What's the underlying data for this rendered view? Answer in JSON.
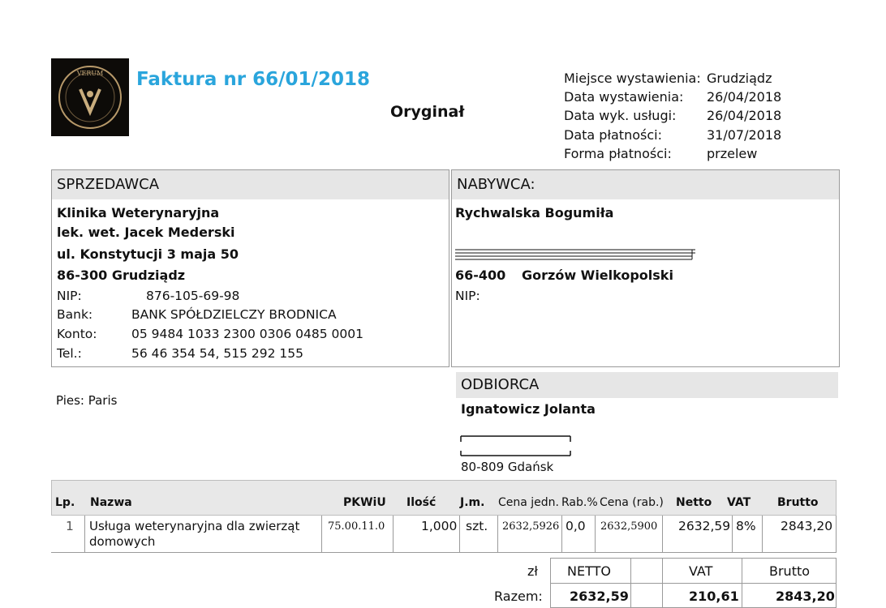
{
  "invoice": {
    "title": "Faktura nr 66/01/2018",
    "copy_type": "Oryginał",
    "logo_text": "VERUM"
  },
  "meta": [
    {
      "label": "Miejsce wystawienia:",
      "value": "Grudziądz"
    },
    {
      "label": "Data wystawienia:",
      "value": "26/04/2018"
    },
    {
      "label": "Data wyk. usługi:",
      "value": "26/04/2018"
    },
    {
      "label": "Data płatności:",
      "value": "31/07/2018"
    },
    {
      "label": "Forma płatności:",
      "value": "przelew"
    }
  ],
  "seller": {
    "heading": "SPRZEDAWCA",
    "name1": "Klinika Weterynaryjna",
    "name2": "lek. wet. Jacek Mederski",
    "street": "ul. Konstytucji 3 maja 50",
    "city": "86-300 Grudziądz",
    "nip_label": "NIP:",
    "nip": "876-105-69-98",
    "bank_label": "Bank:",
    "bank": "BANK SPÓŁDZIELCZY BRODNICA",
    "account_label": "Konto:",
    "account": "05 9484 1033 2300 0306 0485 0001",
    "phone_label": "Tel.:",
    "phone": "56 46 354 54, 515 292 155"
  },
  "buyer": {
    "heading": "NABYWCA:",
    "name": "Rychwalska Bogumiła",
    "postcode": "66-400",
    "city": "Gorzów Wielkopolski",
    "nip_label": "NIP:"
  },
  "note": "Pies: Paris",
  "recipient": {
    "heading": "ODBIORCA",
    "name": "Ignatowicz Jolanta",
    "city": "80-809 Gdańsk"
  },
  "table": {
    "headers": {
      "lp": "Lp.",
      "name": "Nazwa",
      "pkwiu": "PKWiU",
      "qty": "Ilość",
      "unit": "J.m.",
      "price": "Cena jedn.",
      "discount": "Rab.%",
      "price_disc": "Cena (rab.)",
      "net": "Netto",
      "vat": "VAT",
      "gross": "Brutto"
    },
    "rows": [
      {
        "lp": "1",
        "name_line1": "Usługa weterynaryjna dla zwierząt",
        "name_line2": "domowych",
        "pkwiu": "75.00.11.0",
        "qty": "1,000",
        "unit": "szt.",
        "price": "2632,5926",
        "discount": "0,0",
        "price_disc": "2632,5900",
        "net": "2632,59",
        "vat": "8%",
        "gross": "2843,20"
      }
    ]
  },
  "summary": {
    "currency": "zł",
    "net_label": "NETTO",
    "vat_label": "VAT",
    "gross_label": "Brutto",
    "total_label": "Razem:",
    "net": "2632,59",
    "vat": "210,61",
    "gross": "2843,20"
  }
}
